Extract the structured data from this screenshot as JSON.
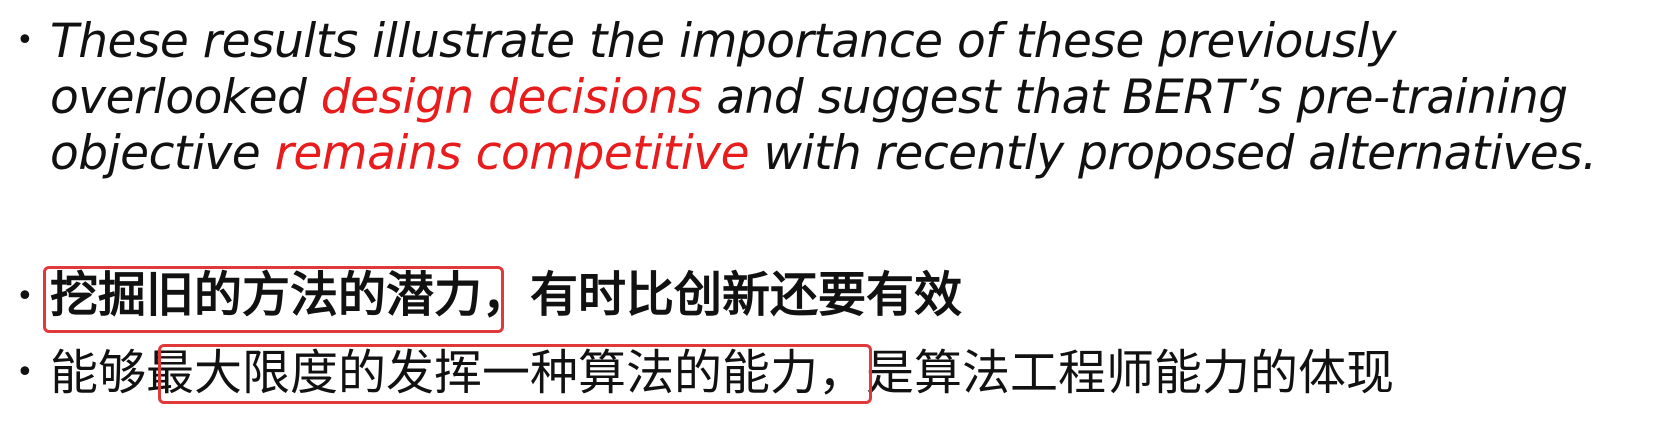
{
  "quote": {
    "line1": "These results illustrate the importance of these previously",
    "line2_pre": "overlooked ",
    "line2_red": "design decisions",
    "line2_post": " and suggest that BERT’s pre-training",
    "line3_pre": "objective ",
    "line3_red": "remains competitive",
    "line3_post": " with recently proposed alternatives."
  },
  "point2": {
    "highlight": "挖掘旧的方法的潜力",
    "rest": "，有时比创新还要有效"
  },
  "point3": {
    "pre": "能够",
    "highlight": "最大限度的发挥一种算法的能力",
    "rest": "，是算法工程师能力的体现"
  },
  "colors": {
    "text": "#111111",
    "emphasis_red": "#e81c1c",
    "box_outline": "#e0393c"
  }
}
